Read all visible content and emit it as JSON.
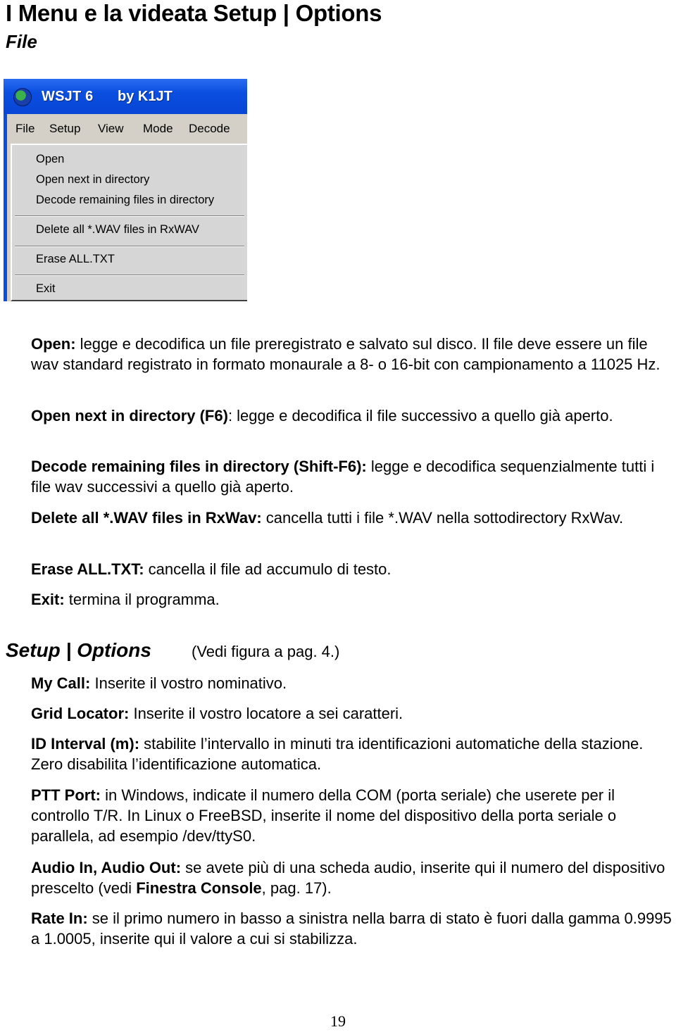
{
  "page": {
    "title": "I Menu e la videata Setup | Options",
    "subtitle": "File",
    "page_number": "19"
  },
  "screenshot": {
    "window_title": "WSJT 6",
    "window_title_by": "by K1JT",
    "title_icon": "globe-icon",
    "menubar": [
      "File",
      "Setup",
      "View",
      "Mode",
      "Decode"
    ],
    "file_menu": {
      "groups": [
        [
          "Open",
          "Open next in directory",
          "Decode remaining files in directory"
        ],
        [
          "Delete all *.WAV files in RxWAV"
        ],
        [
          "Erase ALL.TXT"
        ],
        [
          "Exit"
        ]
      ]
    }
  },
  "file_section": [
    {
      "term": "Open:",
      "text": " legge e decodifica un file preregistrato e salvato sul disco.  Il file deve essere un file wav standard registrato in formato monaurale a 8- o 16-bit con campionamento a 11025 Hz."
    },
    {
      "term": "Open next in directory (F6)",
      "text": ": legge e decodifica il file successivo a quello già aperto."
    },
    {
      "term": "Decode remaining files in directory (Shift-F6):",
      "text": " legge e decodifica sequenzialmente tutti i file wav successivi a quello già aperto."
    },
    {
      "term": "Delete all *.WAV files in RxWav:",
      "text": " cancella tutti i file *.WAV nella sottodirectory RxWav."
    },
    {
      "term": "Erase ALL.TXT:",
      "text": " cancella il file ad accumulo di testo."
    },
    {
      "term": "Exit:",
      "text": " termina il programma."
    }
  ],
  "setup_section": {
    "heading": "Setup | Options",
    "note": "(Vedi figura a pag. 4.)",
    "items": [
      {
        "term": "My Call:",
        "text": " Inserite il vostro nominativo."
      },
      {
        "term": "Grid Locator:",
        "text": " Inserite il vostro locatore a sei caratteri."
      },
      {
        "term": "ID Interval (m):",
        "text": " stabilite l’intervallo in minuti tra identificazioni automatiche della stazione.  Zero disabilita l’identificazione automatica."
      },
      {
        "term": "PTT Port:",
        "text": " in Windows, indicate il numero della COM (porta seriale) che userete per il controllo T/R.  In Linux o FreeBSD, inserite il nome del dispositivo della porta seriale o parallela, ad esempio /dev/ttyS0."
      },
      {
        "term": "Audio In, Audio Out:",
        "text": " se avete più di una scheda audio, inserite qui il numero del dispositivo prescelto (vedi ",
        "bold2": "Finestra Console",
        "text2": ", pag. 17)."
      },
      {
        "term": "Rate In:",
        "text": "  se il primo numero in basso a sinistra nella barra di stato è fuori dalla gamma 0.9995 a 1.0005, inserite qui il valore a cui si stabilizza."
      }
    ]
  }
}
